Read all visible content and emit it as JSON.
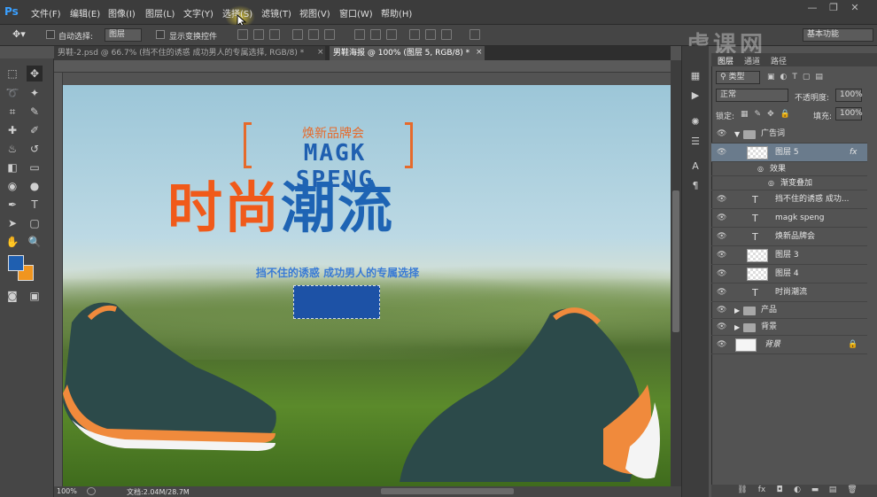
{
  "app": {
    "logo": "Ps"
  },
  "menu": [
    "文件(F)",
    "编辑(E)",
    "图像(I)",
    "图层(L)",
    "文字(Y)",
    "选择(S)",
    "滤镜(T)",
    "视图(V)",
    "窗口(W)",
    "帮助(H)"
  ],
  "window_controls": {
    "minimize": "—",
    "restore": "❐",
    "close": "✕"
  },
  "options": {
    "auto_select_label": "自动选择:",
    "auto_select_value": "图层",
    "transform_label": "显示变换控件",
    "workspace": "基本功能"
  },
  "tabs": [
    {
      "label": "男鞋-2.psd @ 66.7% (挡不住的诱惑  成功男人的专属选择, RGB/8) *",
      "close": "×"
    },
    {
      "label": "男鞋海报 @ 100% (图层 5, RGB/8) *",
      "close": "×"
    }
  ],
  "canvas": {
    "brand_cn": "焕新品牌会",
    "brand_en": "MAGK SPENG",
    "slogan_part1": "时尚",
    "slogan_part2": "潮流",
    "slogan_sub": "挡不住的诱惑  成功男人的专属选择",
    "colors": {
      "orange": "#f05a1a",
      "blue": "#1e64b4",
      "box": "#1d52a6"
    }
  },
  "status": {
    "zoom": "100%",
    "doc": "文档:2.04M/28.7M"
  },
  "layers_panel": {
    "tabs": [
      "图层",
      "通道",
      "路径"
    ],
    "filter_label": "类型",
    "blend_mode": "正常",
    "opacity_label": "不透明度:",
    "opacity_value": "100%",
    "lock_label": "锁定:",
    "fill_label": "填充:",
    "fill_value": "100%",
    "layers": [
      {
        "name": "广告词",
        "type": "group-open"
      },
      {
        "name": "图层 5",
        "type": "pixel",
        "selected": true,
        "fx": "fx"
      },
      {
        "name": "效果",
        "type": "effect"
      },
      {
        "name": "渐变叠加",
        "type": "effect-item"
      },
      {
        "name": "挡不住的诱惑  成功...",
        "type": "text"
      },
      {
        "name": "magk speng",
        "type": "text"
      },
      {
        "name": "焕新品牌会",
        "type": "text"
      },
      {
        "name": "图层 3",
        "type": "pixel"
      },
      {
        "name": "图层 4",
        "type": "pixel"
      },
      {
        "name": "时尚潮流",
        "type": "text"
      },
      {
        "name": "产品",
        "type": "group"
      },
      {
        "name": "背景",
        "type": "group"
      },
      {
        "name": "背景",
        "type": "background"
      }
    ]
  },
  "watermark": "虎课网"
}
